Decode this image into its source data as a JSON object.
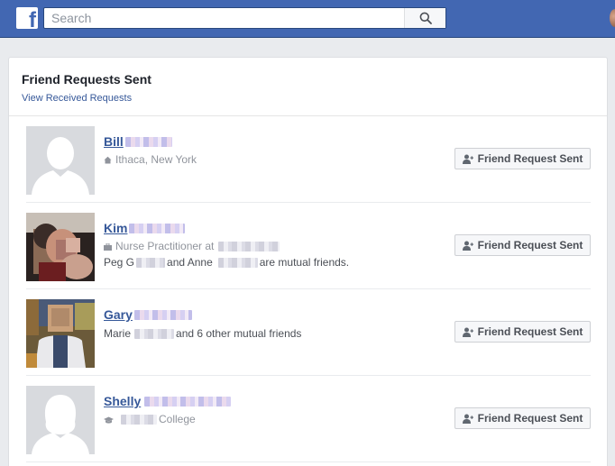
{
  "topbar": {
    "logo_letter": "f",
    "search_placeholder": "Search",
    "icons": {
      "search": "search-icon",
      "logo": "facebook-logo-icon",
      "profile": "avatar"
    }
  },
  "card": {
    "title": "Friend Requests Sent",
    "link": "View Received Requests"
  },
  "requests": [
    {
      "name": "Bill",
      "meta": "Ithaca, New York",
      "meta_icon": "home-icon",
      "mutual_a": "",
      "mutual_b": "",
      "mutual_c": "",
      "button": "Friend Request Sent",
      "photo": "default-silhouette"
    },
    {
      "name": "Kim",
      "meta": "Nurse Practitioner at",
      "meta_icon": "briefcase-icon",
      "mutual_a": "Peg G",
      "mutual_b": "and Anne",
      "mutual_c": "are mutual friends.",
      "button": "Friend Request Sent",
      "photo": "profile-photo"
    },
    {
      "name": "Gary",
      "meta": "",
      "meta_icon": "",
      "mutual_a": "Marie",
      "mutual_b": "and 6 other mutual friends",
      "mutual_c": "",
      "button": "Friend Request Sent",
      "photo": "profile-photo"
    },
    {
      "name": "Shelly",
      "meta": "College",
      "meta_icon": "graduation-cap-icon",
      "mutual_a": "",
      "mutual_b": "",
      "mutual_c": "",
      "button": "Friend Request Sent",
      "photo": "default-silhouette"
    }
  ],
  "colors": {
    "brand": "#4267b2",
    "link": "#365899",
    "page_bg": "#e9ebee"
  }
}
